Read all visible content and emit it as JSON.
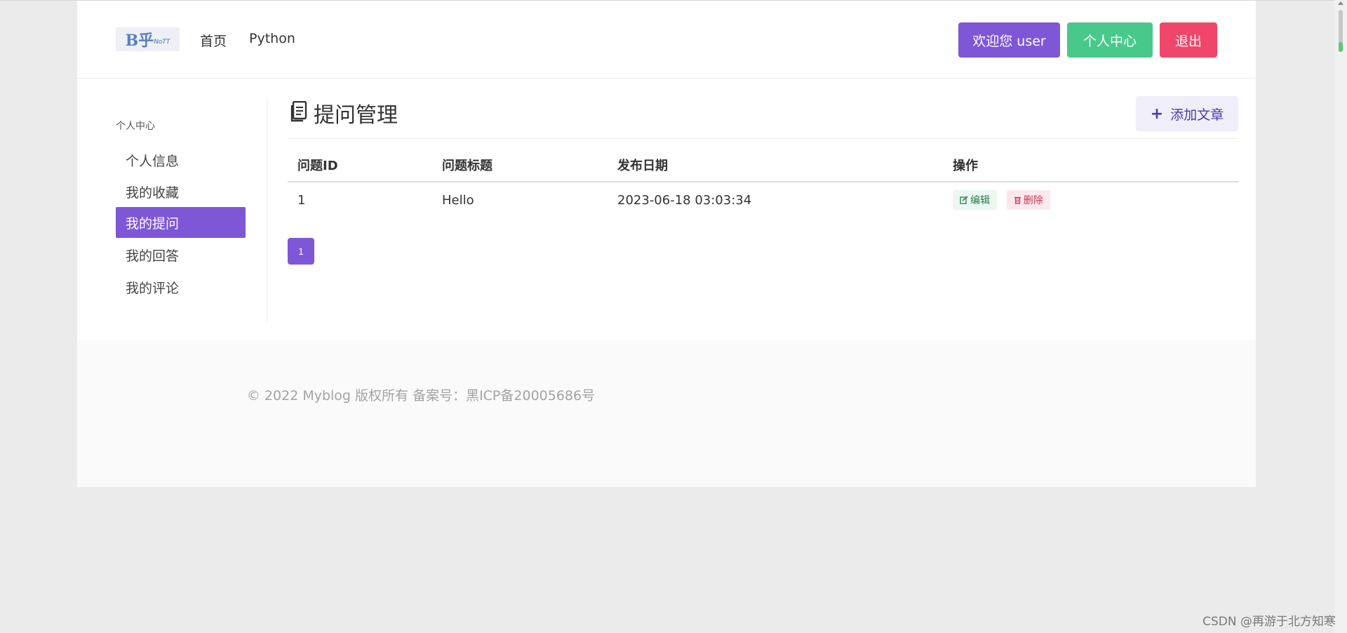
{
  "header": {
    "logo": {
      "main": "B乎",
      "small": "NoTT"
    },
    "nav": [
      "首页",
      "Python"
    ],
    "welcome_button": "欢迎您 user",
    "center_button": "个人中心",
    "logout_button": "退出"
  },
  "sidebar": {
    "title": "个人中心",
    "items": [
      {
        "label": "个人信息",
        "active": false
      },
      {
        "label": "我的收藏",
        "active": false
      },
      {
        "label": "我的提问",
        "active": true
      },
      {
        "label": "我的回答",
        "active": false
      },
      {
        "label": "我的评论",
        "active": false
      }
    ]
  },
  "main": {
    "title": "提问管理",
    "add_button": "添加文章",
    "columns": [
      "问题ID",
      "问题标题",
      "发布日期",
      "操作"
    ],
    "rows": [
      {
        "id": "1",
        "title": "Hello",
        "date": "2023-06-18 03:03:34"
      }
    ],
    "edit_label": "编辑",
    "delete_label": "删除",
    "pagination": [
      "1"
    ]
  },
  "footer": {
    "text": "© 2022 Myblog 版权所有 备案号：黑ICP备20005686号"
  },
  "watermark": "CSDN @再游于北方知寒",
  "colors": {
    "primary": "#7e57d6",
    "success": "#48c98b",
    "danger": "#f0466b"
  }
}
